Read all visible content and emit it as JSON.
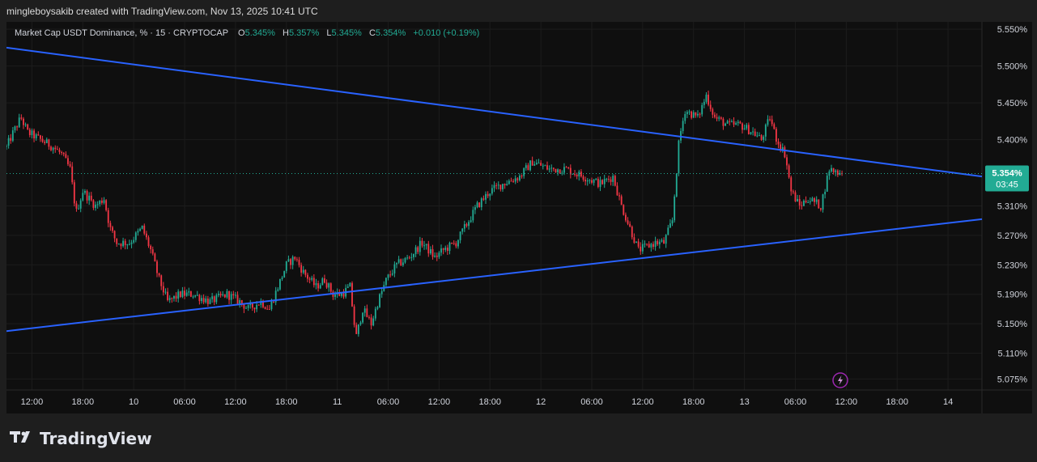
{
  "header": {
    "attribution": "mingleboysakib created with TradingView.com, Nov 13, 2025 10:41 UTC"
  },
  "legend": {
    "symbol": "Market Cap USDT Dominance, % · 15 · CRYPTOCAP",
    "open_label": "O",
    "open_value": "5.345%",
    "high_label": "H",
    "high_value": "5.357%",
    "low_label": "L",
    "low_value": "5.345%",
    "close_label": "C",
    "close_value": "5.354%",
    "change": "+0.010 (+0.19%)"
  },
  "colors": {
    "up": "#22ab94",
    "down": "#f23645",
    "trendline": "#2962ff",
    "price_badge": "#22ab94",
    "background": "#0f0f0f"
  },
  "price_label": {
    "value": "5.354%",
    "countdown": "03:45"
  },
  "footer": {
    "brand": "TradingView",
    "logo_icon": "tradingview-logo-icon"
  },
  "chart_data": {
    "type": "candlestick",
    "title": "Market Cap USDT Dominance, % · 15 · CRYPTOCAP",
    "ylim": [
      5.06,
      5.56
    ],
    "y_ticks": [
      "5.550%",
      "5.500%",
      "5.450%",
      "5.400%",
      "5.310%",
      "5.270%",
      "5.230%",
      "5.190%",
      "5.150%",
      "5.110%",
      "5.075%"
    ],
    "x_ticks": [
      "12:00",
      "18:00",
      "10",
      "06:00",
      "12:00",
      "18:00",
      "11",
      "06:00",
      "12:00",
      "18:00",
      "12",
      "06:00",
      "12:00",
      "18:00",
      "13",
      "06:00",
      "12:00",
      "18:00",
      "14"
    ],
    "x_tick_hours": [
      0,
      6,
      12,
      18,
      24,
      30,
      36,
      42,
      48,
      54,
      60,
      66,
      72,
      78,
      84,
      90,
      96,
      102,
      108
    ],
    "x_range_hours": [
      -3,
      112
    ],
    "last_close_hour": 95.5,
    "anchors": [
      [
        -3,
        5.39
      ],
      [
        -2.2,
        5.41
      ],
      [
        -1.3,
        5.43
      ],
      [
        -0.5,
        5.41
      ],
      [
        1,
        5.4
      ],
      [
        2.5,
        5.39
      ],
      [
        3.5,
        5.38
      ],
      [
        4.5,
        5.36
      ],
      [
        5.2,
        5.3
      ],
      [
        6,
        5.33
      ],
      [
        7.5,
        5.31
      ],
      [
        8.5,
        5.32
      ],
      [
        9.2,
        5.28
      ],
      [
        10,
        5.26
      ],
      [
        11.5,
        5.26
      ],
      [
        13,
        5.28
      ],
      [
        14,
        5.25
      ],
      [
        15,
        5.21
      ],
      [
        16,
        5.18
      ],
      [
        17.5,
        5.19
      ],
      [
        19,
        5.19
      ],
      [
        21,
        5.18
      ],
      [
        23,
        5.19
      ],
      [
        24.5,
        5.18
      ],
      [
        25.5,
        5.17
      ],
      [
        27,
        5.18
      ],
      [
        28,
        5.17
      ],
      [
        29,
        5.2
      ],
      [
        30,
        5.23
      ],
      [
        31,
        5.24
      ],
      [
        32,
        5.22
      ],
      [
        33.5,
        5.2
      ],
      [
        34.5,
        5.21
      ],
      [
        35.5,
        5.19
      ],
      [
        36.5,
        5.19
      ],
      [
        37.5,
        5.2
      ],
      [
        38.2,
        5.13
      ],
      [
        39,
        5.17
      ],
      [
        40,
        5.15
      ],
      [
        40.8,
        5.18
      ],
      [
        41.8,
        5.21
      ],
      [
        43,
        5.23
      ],
      [
        44.5,
        5.24
      ],
      [
        46,
        5.26
      ],
      [
        47.5,
        5.24
      ],
      [
        48.5,
        5.25
      ],
      [
        50,
        5.26
      ],
      [
        51.5,
        5.29
      ],
      [
        52.5,
        5.31
      ],
      [
        54,
        5.33
      ],
      [
        55.5,
        5.34
      ],
      [
        57.5,
        5.35
      ],
      [
        59,
        5.37
      ],
      [
        61,
        5.36
      ],
      [
        63,
        5.36
      ],
      [
        65,
        5.35
      ],
      [
        67,
        5.34
      ],
      [
        68.5,
        5.35
      ],
      [
        69.5,
        5.31
      ],
      [
        70.5,
        5.28
      ],
      [
        71.5,
        5.25
      ],
      [
        73.5,
        5.26
      ],
      [
        74.5,
        5.26
      ],
      [
        75.5,
        5.29
      ],
      [
        76.3,
        5.4
      ],
      [
        77,
        5.44
      ],
      [
        78.5,
        5.43
      ],
      [
        79.5,
        5.46
      ],
      [
        80.5,
        5.43
      ],
      [
        82,
        5.42
      ],
      [
        83.5,
        5.42
      ],
      [
        85,
        5.41
      ],
      [
        86,
        5.4
      ],
      [
        87,
        5.43
      ],
      [
        87.8,
        5.4
      ],
      [
        88.8,
        5.38
      ],
      [
        89.5,
        5.33
      ],
      [
        90.5,
        5.31
      ],
      [
        91.5,
        5.32
      ],
      [
        93,
        5.31
      ],
      [
        94,
        5.36
      ],
      [
        95.5,
        5.354
      ]
    ],
    "trendlines": [
      {
        "from": [
          -3,
          5.525
        ],
        "to": [
          112,
          5.35
        ]
      },
      {
        "from": [
          -3,
          5.14
        ],
        "to": [
          112,
          5.292
        ]
      }
    ]
  }
}
